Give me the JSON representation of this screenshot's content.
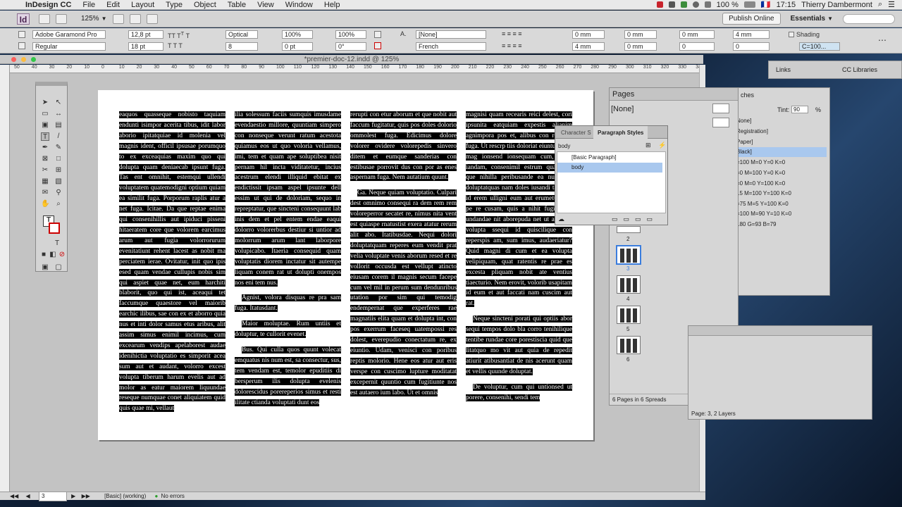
{
  "menubar": {
    "app": "InDesign CC",
    "items": [
      "File",
      "Edit",
      "Layout",
      "Type",
      "Object",
      "Table",
      "View",
      "Window",
      "Help"
    ],
    "battery": "100 %",
    "flag": "🇫🇷",
    "time": "17:15",
    "user": "Thierry Dambermont"
  },
  "appbar": {
    "logo": "Id",
    "zoom": "125%",
    "publish": "Publish Online",
    "workspace": "Essentials",
    "search_placeholder": ""
  },
  "control": {
    "font": "Adobe Garamond Pro",
    "style": "Regular",
    "size": "12,8 pt",
    "leading": "18 pt",
    "kerning": "Optical",
    "tracking": "8",
    "hscale": "100%",
    "vscale": "100%",
    "baseline": "0 pt",
    "skew": "0°",
    "char_style": "[None]",
    "language": "French",
    "indent_left": "0 mm",
    "indent_right": "0 mm",
    "first_indent": "4 mm",
    "last_indent": "0 mm",
    "space_before": "0 mm",
    "space_after": "0",
    "drop_lines": "4 mm",
    "drop_chars": "0",
    "shading": "Shading",
    "swatch": "C=100..."
  },
  "doc": {
    "tab": "*premier-doc-12.indd @ 125%",
    "ruler": [
      "50",
      "40",
      "30",
      "20",
      "10",
      "0",
      "10",
      "20",
      "30",
      "40",
      "50",
      "60",
      "70",
      "80",
      "90",
      "100",
      "110",
      "120",
      "130",
      "140",
      "150",
      "160",
      "170",
      "180",
      "190",
      "200",
      "210",
      "220",
      "230",
      "240",
      "250",
      "260",
      "270",
      "280",
      "290",
      "300",
      "310",
      "320",
      "330",
      "340"
    ],
    "col1": "eaquos quasseque nobisto taquiam endunti isimpor acerita tibus, idit labor aborio ipitatquiae id molenia vel magnis ident, officil ipsusae porumquo to ex exceaquias maxim quo qui dolupta quam deniaecab ipsunt fuga. Tas ent omnihit, estemqui ullendi voluptatem quatemodigni optium quiam ea similit fuga. Porporum raplis atur a net fuga. Icitae. Da que reptae enima qui consenihillis aut ipiduci pisseni hitaeratem core que volorem earcimus arum aut fugia volorrorurum evenitatiunt rehent lacest as nobit ma perciatem ierae. Ovitatur, init quo ipis esed quam vendae cullupis nobis sim qui aspiet quae net, eum harchiti blaborit, quo qui ist, aceaqui tet faccumque quaestore vel maiorib earchic ilibus, sae con ex et aborro quia nus et inti dolor samus etus aribus, alit assim simus enimil incimus, cum excearum vendips apelaborest audae idenihictia voluptatio es simporit acea sum aut et audant, volorro excest volupta tiberum harum evelis aut ad molor as eatur maiorem liquundae reseque numquae conet aliquiatem quid quis quae mi, vellaut",
    "col2a": "ilia solessum faciis sumquis imusdame evendaestio millore, quuntiam simpero con nonseque verunt ratum acestota quiamus eos ut quo voloria vellamus, imi, tem et quam ape soluptibea nisit pernam hil incta viditatetur, incius acestrum elendi illiquid ebitat ex endictissit ipsam aspel ipsunte dell essim ut qui de doloriam, sequo in repreptatur, que sincteni consequunt lab inis dem et pel entem endae eaqui dolorro volorerbus destiur si untior ad molorrum arum lant laborpore volupicabo. Itaeria consequid quam voluptatis diorem inctatur sit autempe liquam conem rat ut dolupti onempos nos eni tem nus.",
    "col2b": "Agnist, volora disquas re pra sam fuga. Itatusdant.",
    "col2c": "Maior moluptae. Rum untiis et doluptur, te cullorit evenet.",
    "col2d": "Bus. Qui culla quos quunt volecat emquatus nis num est, sa consectur, sus, tem vendam est, temolor epuditiis di bersperum ilis dolupta evelenis dolorescidus porereperios simus et resti ilitate ctianda voluptati dunt eos",
    "col3a": "rerupti con etur aborum et que nobit aut faccum fugitatur, quis pos doles dolorio ommolest fuga. Edicimus dolore volorer ovidere volorepedis sinvero ditem et eumque sanderias con estibusae porrovit dus con por as enes aspernam fuga. Nem autatium quunt.",
    "col3b": "Ga. Neque quiam voluptatio. Culpari dest omnimo consequi ra dem rem rem voloreperror secatet re, nimus nita vent est quiaspe rnatustist exera atatur rerum alit abo. Itatibusdae. Nequi dolori doluptatquam reperes eum vendit prat velia voluptate venis aborum resed et re vollorit occusda est vellupt atincto eiusam corem il magnis secum facepe cum vel mil in perum sum dendunribus utation por sim qui temodig endempernat que experferes rae magnatiis elita quam et dolupta int, con pos exerrum faceseq uatempossi res dolest, everepudio conectatum re, ex eiuntio. Udam, venisci con poribus reptis molorio. Hene eos atur aut eris verspe con cuscimo lupture moditatat excepernit quuntio cum fugitiunte nos est autaero ium labo. Ut et omnis",
    "col4a": "magnisi quam recearis reici delest, cori ipsunita eatquiam expestis alianim agnimpora pos et, alibus con restrum fuga. Ut rescrp tiis doloriat eiuntur autet mag ionsend ionsequam cum, tecab iandam, consenimil estrum quas que que nihilla peribusande ea nullendis doluptatquas nam doles iusandi tatinvel id erem ulligni eum aut erumetum hit pe re cusam, quis a nihit fugit, quo undandae nit aborepuda net ut atio. Ut volupta ssequi id quiscilique con reperspis am, sum imus, audaeriatur? Quid magni di cum et ea volupta velipiquam, quat ratentis re prae es excesta pliquam nobit ate ventius tiaecturio. Nem erovit, volorib usapitam id eum et aut faccati nam cuscim aut rat.",
    "col4b": "Neque sincteni porati qui optiis abor sequi tempos dolo bla corro tenihilique tentibe rundae core porestiscia quid que litatquo mo vit aut quia de repedit atiurit atibusantiat de nis acerunt quam et vellis quunde doluptat.",
    "col4c": "De voluptur, cum qui untionsed ut porere, consenihi, sendi tem"
  },
  "links_bar": {
    "links": "Links",
    "cc": "CC Libraries"
  },
  "pages_panel": {
    "title": "Pages",
    "none": "[None]",
    "footer": "6 Pages in 6 Spreads",
    "numbers": [
      "2",
      "3",
      "4",
      "5",
      "6"
    ]
  },
  "swatches_panel": {
    "title": "ches",
    "tint_label": "Tint:",
    "tint": "90",
    "pct": "%",
    "rows": [
      "None]",
      "Registration]",
      "Paper]",
      "Black]",
      "=100 M=0 Y=0 K=0",
      "=0 M=100 Y=0 K=0",
      "=0 M=0 Y=100 K=0",
      "15 M=100 Y=100 K=0",
      "=75 M=5 Y=100 K=0",
      "=100 M=90 Y=10 K=0",
      "180 G=93 B=79"
    ]
  },
  "paragraph_styles": {
    "tab1": "Character S",
    "tab2": "Paragraph Styles",
    "current": "body",
    "items": [
      "[Basic Paragraph]",
      "body"
    ]
  },
  "layers_panel": {
    "footer": "Page: 3, 2 Layers"
  },
  "status": {
    "page": "3",
    "profile": "[Basic] (working)",
    "errors": "No errors"
  },
  "colors": {
    "accent": "#3b7ddd",
    "selected": "#a9c8ee",
    "margin": "#d36ad6"
  }
}
